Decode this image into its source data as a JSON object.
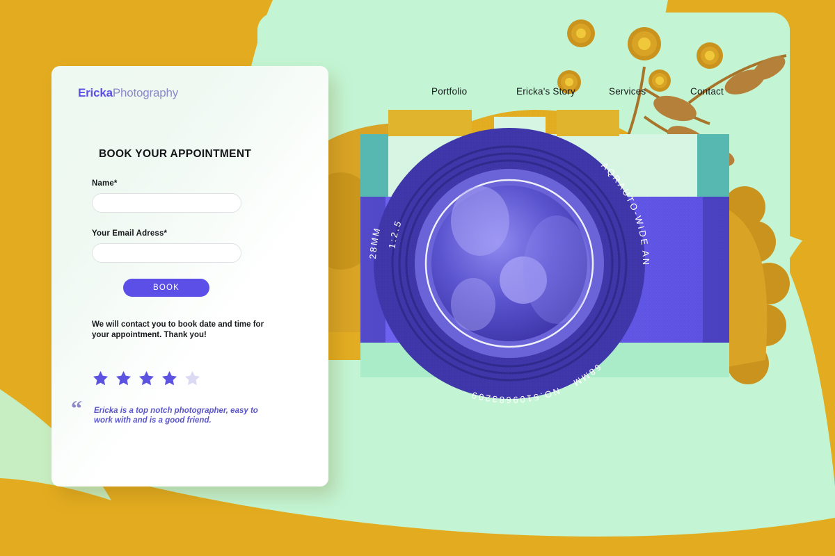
{
  "page": {
    "type": "photography-booking-landing-page",
    "background_color": "#e3ac20",
    "hero_panel_color": "#c3f5d4",
    "card_color": "#ffffff",
    "accent_purple": "#5b4fe8",
    "accent_purple_light": "#8d87c9",
    "gold": "#e3ac20",
    "gold_dark": "#b98415",
    "mint": "#c3f5d4"
  },
  "brand": {
    "name_strong": "Ericka",
    "name_light": "Photography"
  },
  "nav": {
    "items": [
      {
        "label": "Portfolio"
      },
      {
        "label": "Ericka's Story"
      },
      {
        "label": "Services"
      },
      {
        "label": "Contact"
      }
    ]
  },
  "form": {
    "title": "BOOK YOUR APPOINTMENT",
    "fields": [
      {
        "label": "Name*",
        "value": "",
        "placeholder": ""
      },
      {
        "label": "Your Email Adress*",
        "value": "",
        "placeholder": ""
      }
    ],
    "submit_label": "BOOK",
    "note": "We will contact you to book date and time for your appointment. Thank you!"
  },
  "rating": {
    "value": 4,
    "max": 5,
    "filled_color": "#5c53e0",
    "empty_color": "#dcd9f5"
  },
  "testimonial": {
    "quote_mark": "“",
    "text": "Ericka is a top notch photographer, easy to work with and is a good friend."
  },
  "illustration": {
    "subject": "vintage camera with sunflowers",
    "lens_markings": {
      "brand": "AQR",
      "angle": "AUTO-WIDE ANGLE",
      "aperture": "1:2.5",
      "focal_length": "28MM",
      "filter_size": "68MM",
      "serial": "NO.5109683209"
    }
  }
}
